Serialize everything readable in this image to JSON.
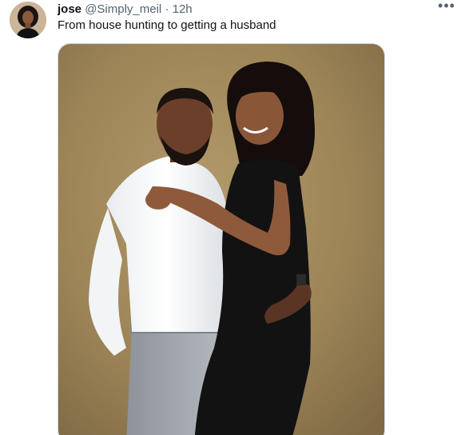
{
  "tweet": {
    "author_name": "jose",
    "author_handle": "@Simply_meil",
    "separator": "·",
    "timestamp": "12h",
    "text": "From house hunting to getting a husband",
    "more_icon": "more-horizontal-icon"
  },
  "colors": {
    "text_primary": "#0f1419",
    "text_secondary": "#536471",
    "backdrop": "#9c8457"
  }
}
